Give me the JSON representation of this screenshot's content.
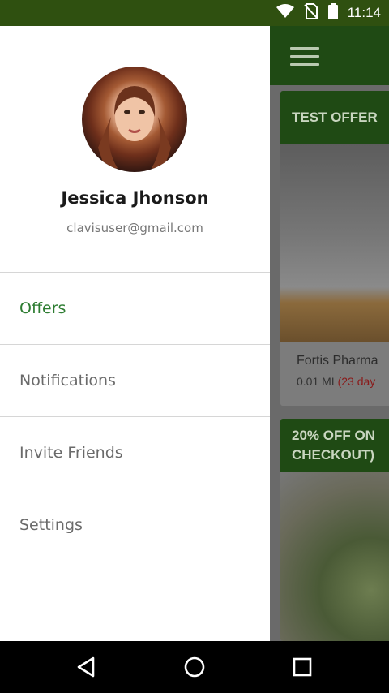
{
  "status_bar": {
    "time": "11:14",
    "icons": [
      "wifi-icon",
      "no-sim-icon",
      "battery-icon"
    ],
    "background_color": "#2f5010"
  },
  "app_background": {
    "cards": [
      {
        "header": "TEST OFFER",
        "store": "Fortis Pharma",
        "distance": "0.01 MI",
        "days": "(23 day"
      },
      {
        "header_line1": "20% OFF ON",
        "header_line2": "CHECKOUT)"
      }
    ]
  },
  "drawer": {
    "user": {
      "name": "Jessica Jhonson",
      "email": "clavisuser@gmail.com"
    },
    "menu": [
      {
        "label": "Offers",
        "active": true
      },
      {
        "label": "Notifications",
        "active": false
      },
      {
        "label": "Invite Friends",
        "active": false
      },
      {
        "label": "Settings",
        "active": false
      }
    ],
    "accent_color": "#2e7d32"
  },
  "navigation_bar": {
    "buttons": [
      "back-icon",
      "home-icon",
      "recents-icon"
    ]
  }
}
